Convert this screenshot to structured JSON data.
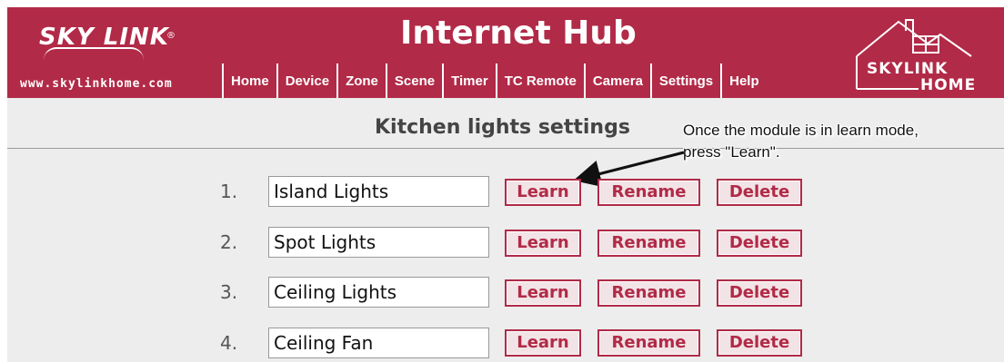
{
  "brand": {
    "logo_text": "SKY LINK",
    "registered": "®",
    "website": "www.skylinkhome.com",
    "app_title": "Internet Hub",
    "home_logo_line1": "SKYLINK",
    "home_logo_line2": "HOME",
    "color_primary": "#b12a47"
  },
  "nav": {
    "items": [
      {
        "label": "Home"
      },
      {
        "label": "Device"
      },
      {
        "label": "Zone"
      },
      {
        "label": "Scene"
      },
      {
        "label": "Timer"
      },
      {
        "label": "TC Remote"
      },
      {
        "label": "Camera"
      },
      {
        "label": "Settings"
      },
      {
        "label": "Help"
      }
    ]
  },
  "page": {
    "title": "Kitchen lights settings"
  },
  "callout": {
    "line1": "Once the module is in learn mode,",
    "line2": "press \"Learn\"."
  },
  "buttons": {
    "learn": "Learn",
    "rename": "Rename",
    "delete": "Delete"
  },
  "rows": [
    {
      "num": "1.",
      "name": "Island Lights"
    },
    {
      "num": "2.",
      "name": "Spot Lights"
    },
    {
      "num": "3.",
      "name": "Ceiling Lights"
    },
    {
      "num": "4.",
      "name": "Ceiling Fan"
    }
  ]
}
